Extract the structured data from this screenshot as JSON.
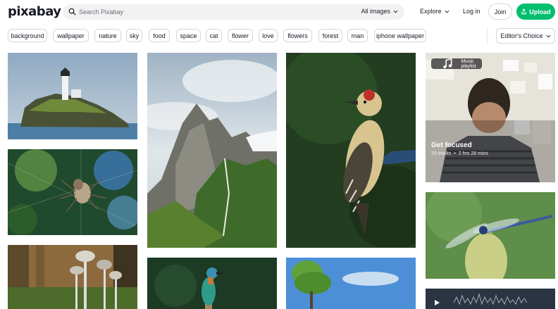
{
  "header": {
    "logo": "pixabay",
    "search_placeholder": "Search Pixabay",
    "filter_label": "All images",
    "explore_label": "Explore",
    "login_label": "Log in",
    "join_label": "Join",
    "upload_label": "Upload",
    "accent_color": "#02be6e"
  },
  "tags": [
    "background",
    "wallpaper",
    "nature",
    "sky",
    "food",
    "space",
    "cat",
    "flower",
    "love",
    "flowers",
    "forest",
    "man",
    "iphone wallpaper"
  ],
  "sort": {
    "label": "Editor's Choice"
  },
  "music": {
    "badge": "Music playlist",
    "title": "Get focused",
    "tracks": "29 tracks",
    "separator": "•",
    "duration": "2 hrs 28 mins"
  }
}
